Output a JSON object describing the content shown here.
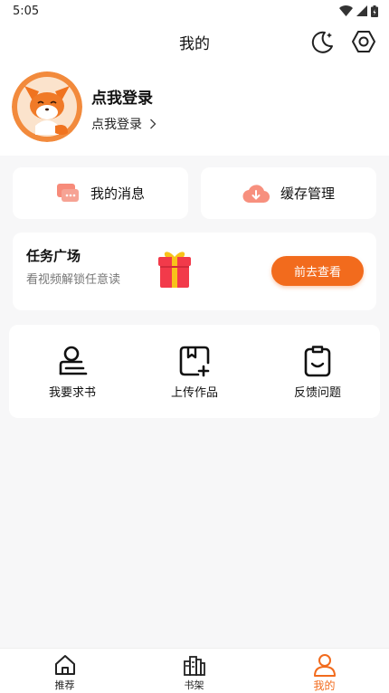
{
  "status_bar": {
    "time": "5:05"
  },
  "header": {
    "title": "我的",
    "theme_icon": "moon-icon",
    "settings_icon": "gear-icon"
  },
  "profile": {
    "name": "点我登录",
    "subtitle": "点我登录",
    "avatar_icon": "fox-avatar"
  },
  "quick_actions": [
    {
      "label": "我的消息",
      "icon": "message-icon"
    },
    {
      "label": "缓存管理",
      "icon": "cloud-download-icon"
    }
  ],
  "task": {
    "title": "任务广场",
    "subtitle": "看视频解锁任意读",
    "button": "前去查看",
    "icon": "gift-icon"
  },
  "tools": [
    {
      "label": "我要求书",
      "icon": "request-book-icon"
    },
    {
      "label": "上传作品",
      "icon": "upload-work-icon"
    },
    {
      "label": "反馈问题",
      "icon": "feedback-icon"
    }
  ],
  "tabs": [
    {
      "label": "推荐",
      "icon": "home-icon",
      "active": false
    },
    {
      "label": "书架",
      "icon": "bookshelf-icon",
      "active": false
    },
    {
      "label": "我的",
      "icon": "profile-icon",
      "active": true
    }
  ],
  "colors": {
    "accent": "#f26b1d",
    "background": "#f7f7f8",
    "card": "#ffffff"
  }
}
